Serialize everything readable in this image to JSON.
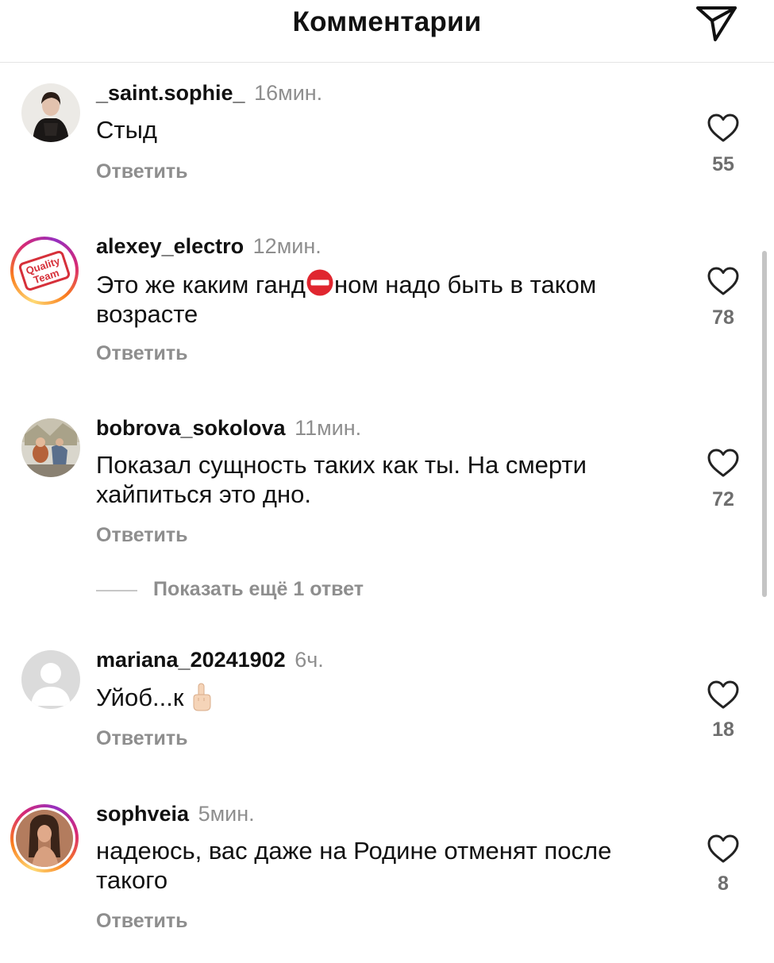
{
  "header": {
    "title": "Комментарии",
    "share_icon": "paper-plane-icon"
  },
  "comments": [
    {
      "username": "_saint.sophie_",
      "time": "16мин.",
      "text": "Стыд",
      "reply_label": "Ответить",
      "likes": "55",
      "avatar": "photo-woman-dark"
    },
    {
      "username": "alexey_electro",
      "time": "12мин.",
      "text_before_emoji": "Это же каким ганд",
      "emoji": "no-entry-emoji",
      "text_after_emoji": "ном надо быть в таком возрасте",
      "reply_label": "Ответить",
      "likes": "78",
      "avatar_lines": [
        "Quality",
        "Team"
      ]
    },
    {
      "username": "bobrova_sokolova",
      "time": "11мин.",
      "text": "Показал сущность таких как ты. На смерти хайпиться это дно.",
      "reply_label": "Ответить",
      "likes": "72",
      "avatar": "photo-painting"
    },
    {
      "username": "mariana_20241902",
      "time": "6ч.",
      "text": "Уйоб...к",
      "emoji": "middle-finger-emoji",
      "reply_label": "Ответить",
      "likes": "18",
      "avatar": "default-avatar"
    },
    {
      "username": "sophveia",
      "time": "5мин.",
      "text": "надеюсь, вас даже на Родине отменят после такого",
      "reply_label": "Ответить",
      "likes": "8",
      "avatar": "photo-woman-portrait"
    }
  ],
  "show_more_replies": "Показать ещё 1 ответ",
  "colors": {
    "text": "#111111",
    "secondary": "#8e8e8e",
    "divider": "#e4e4e4",
    "story_ring": [
      "#feda75",
      "#fa7e1e",
      "#d62976",
      "#962fbf"
    ]
  }
}
